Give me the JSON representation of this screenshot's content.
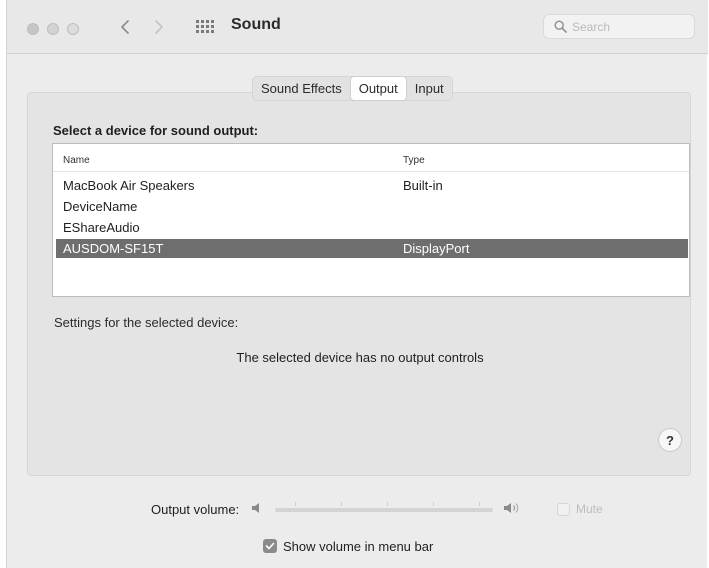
{
  "window": {
    "title": "Sound"
  },
  "search": {
    "placeholder": "Search"
  },
  "tabs": [
    {
      "label": "Sound Effects",
      "active": false
    },
    {
      "label": "Output",
      "active": true
    },
    {
      "label": "Input",
      "active": false
    }
  ],
  "output": {
    "heading": "Select a device for sound output:",
    "columns": {
      "name": "Name",
      "type": "Type"
    },
    "devices": [
      {
        "name": "MacBook Air Speakers",
        "type": "Built-in",
        "selected": false
      },
      {
        "name": "DeviceName",
        "type": "",
        "selected": false
      },
      {
        "name": "EShareAudio",
        "type": "",
        "selected": false
      },
      {
        "name": "AUSDOM-SF15T",
        "type": "DisplayPort",
        "selected": true
      }
    ],
    "settings_label": "Settings for the selected device:",
    "no_controls": "The selected device has no output controls"
  },
  "help": {
    "label": "?"
  },
  "volume": {
    "label": "Output volume:",
    "mute_label": "Mute",
    "mute_checked": false,
    "show_in_menu_bar_label": "Show volume in menu bar",
    "show_in_menu_bar_checked": true
  },
  "icons": {
    "back": "chevron-left-icon",
    "forward": "chevron-right-icon",
    "show_all": "grid-icon",
    "search": "magnifying-glass-icon",
    "volume_low": "speaker-low-icon",
    "volume_high": "speaker-high-icon",
    "checkbox": "checkmark-icon"
  },
  "colors": {
    "selection": "#6e6e6e",
    "window_bg": "#ececec",
    "panel_bg": "#e4e4e4"
  }
}
